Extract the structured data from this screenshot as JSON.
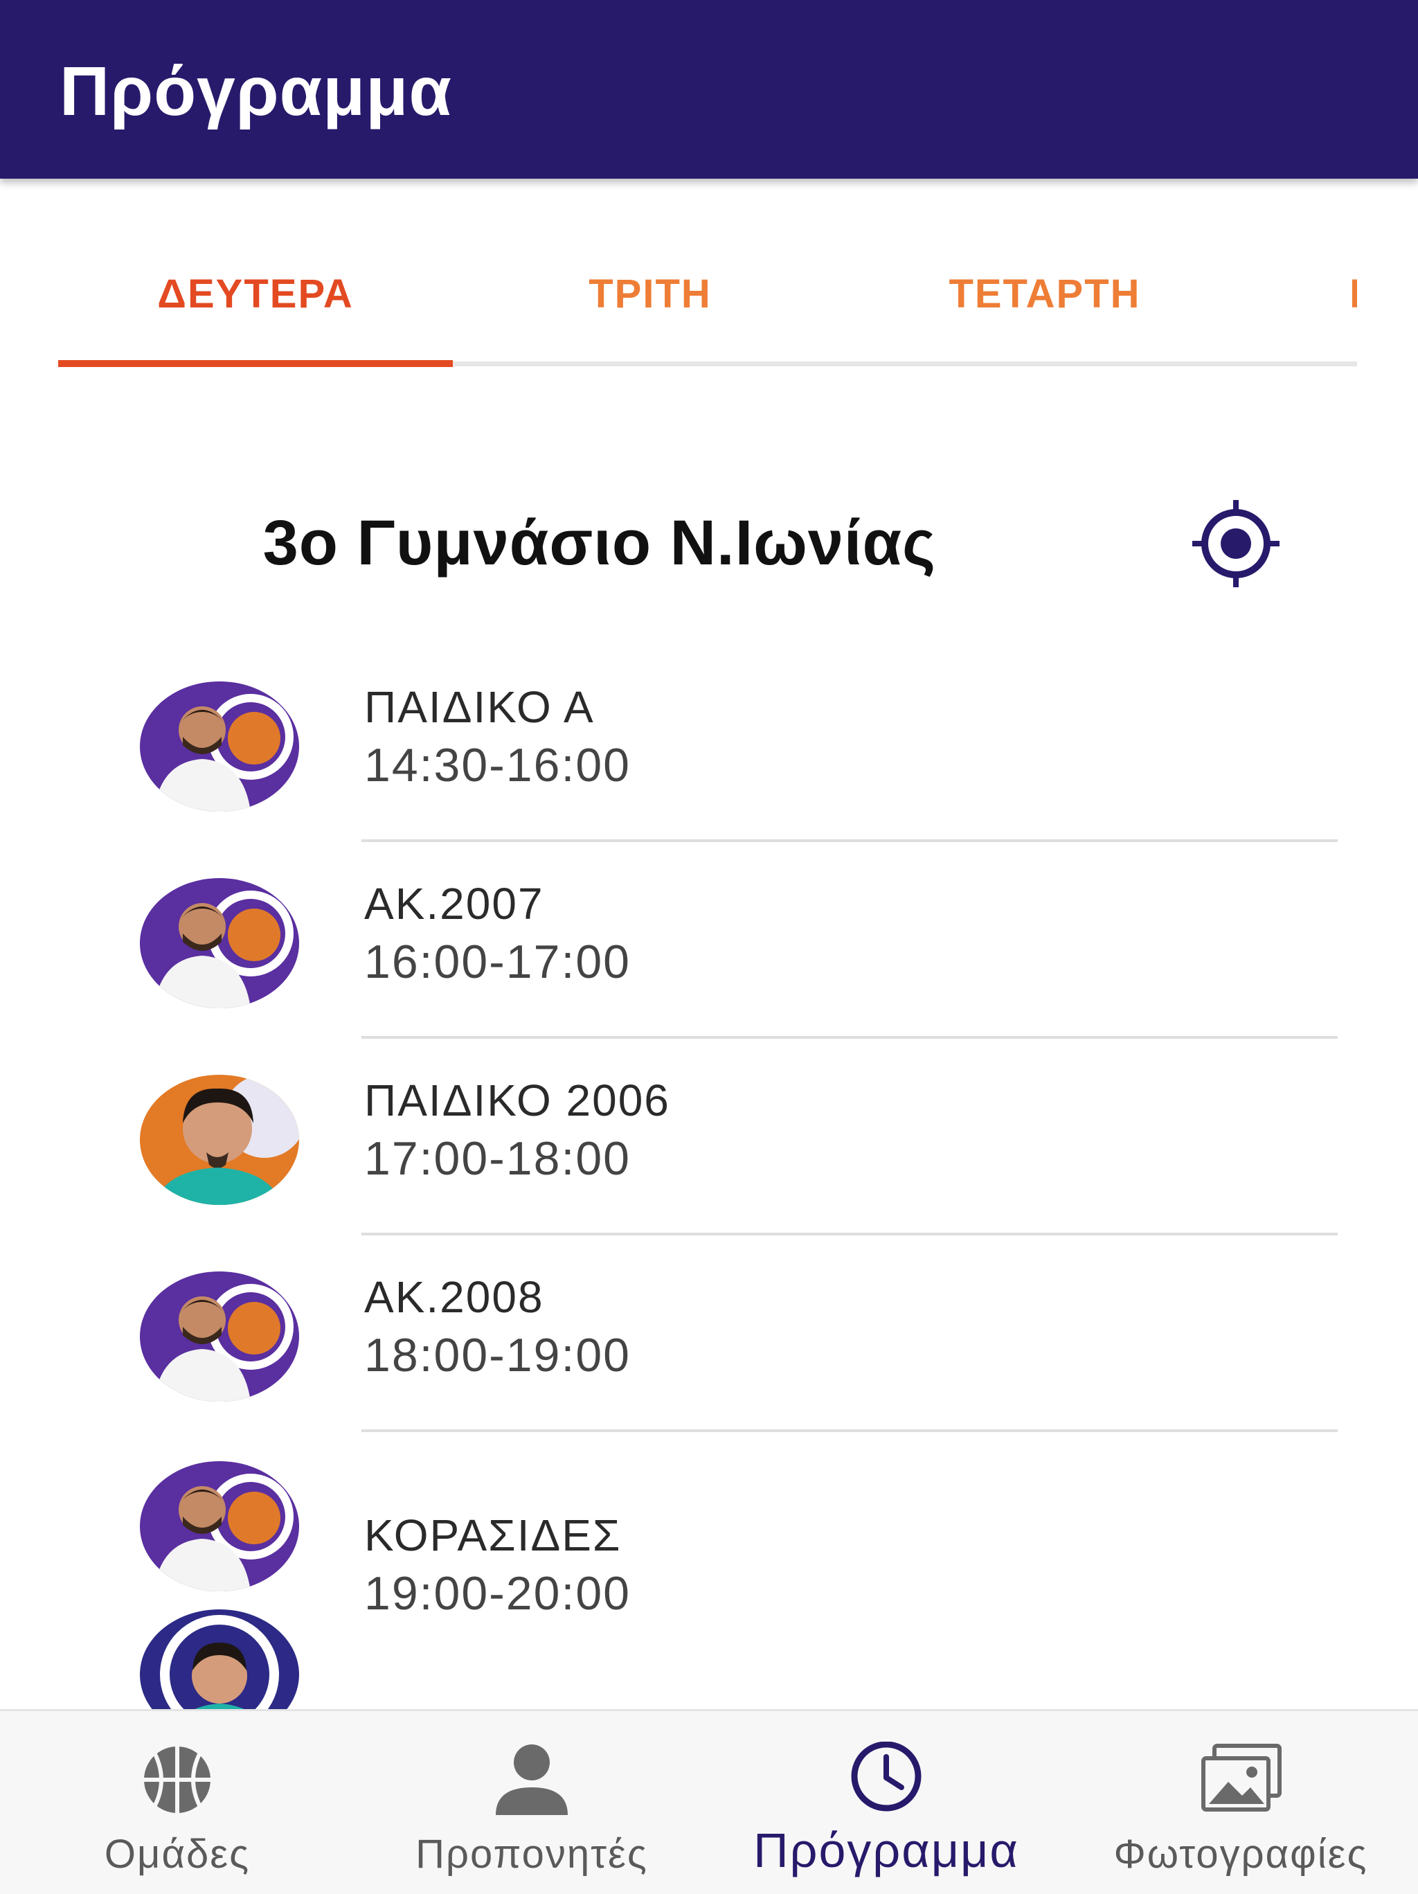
{
  "header": {
    "title": "Πρόγραμμα"
  },
  "tabs": [
    {
      "label": "ΔΕΥΤΕΡΑ",
      "active": true
    },
    {
      "label": "ΤΡΙΤΗ",
      "active": false
    },
    {
      "label": "ΤΕΤΑΡΤΗ",
      "active": false
    },
    {
      "label": "ΠΕΜΠΤΗ",
      "active": false
    }
  ],
  "venue": {
    "name": "3ο Γυμνάσιο Ν.Ιωνίας",
    "location_icon": "location-target-icon"
  },
  "schedule": [
    {
      "team": "ΠΑΙΔΙΚΟ Α",
      "time": "14:30-16:00",
      "coaches": [
        "coach-a"
      ]
    },
    {
      "team": "ΑΚ.2007",
      "time": "16:00-17:00",
      "coaches": [
        "coach-a"
      ]
    },
    {
      "team": "ΠΑΙΔΙΚΟ 2006",
      "time": "17:00-18:00",
      "coaches": [
        "coach-b"
      ]
    },
    {
      "team": "ΑΚ.2008",
      "time": "18:00-19:00",
      "coaches": [
        "coach-a"
      ]
    },
    {
      "team": "ΚΟΡΑΣΙΔΕΣ",
      "time": "19:00-20:00",
      "coaches": [
        "coach-a",
        "coach-c"
      ]
    }
  ],
  "bottom_nav": [
    {
      "label": "Ομάδες",
      "icon": "basketball-icon",
      "active": false
    },
    {
      "label": "Προπονητές",
      "icon": "person-icon",
      "active": false
    },
    {
      "label": "Πρόγραμμα",
      "icon": "clock-icon",
      "active": true
    },
    {
      "label": "Φωτογραφίες",
      "icon": "photos-icon",
      "active": false
    }
  ],
  "colors": {
    "primary": "#271a6b",
    "tab_active": "#e34a22",
    "tab_inactive": "#ee7d36",
    "nav_inactive": "#5a5a5a"
  }
}
